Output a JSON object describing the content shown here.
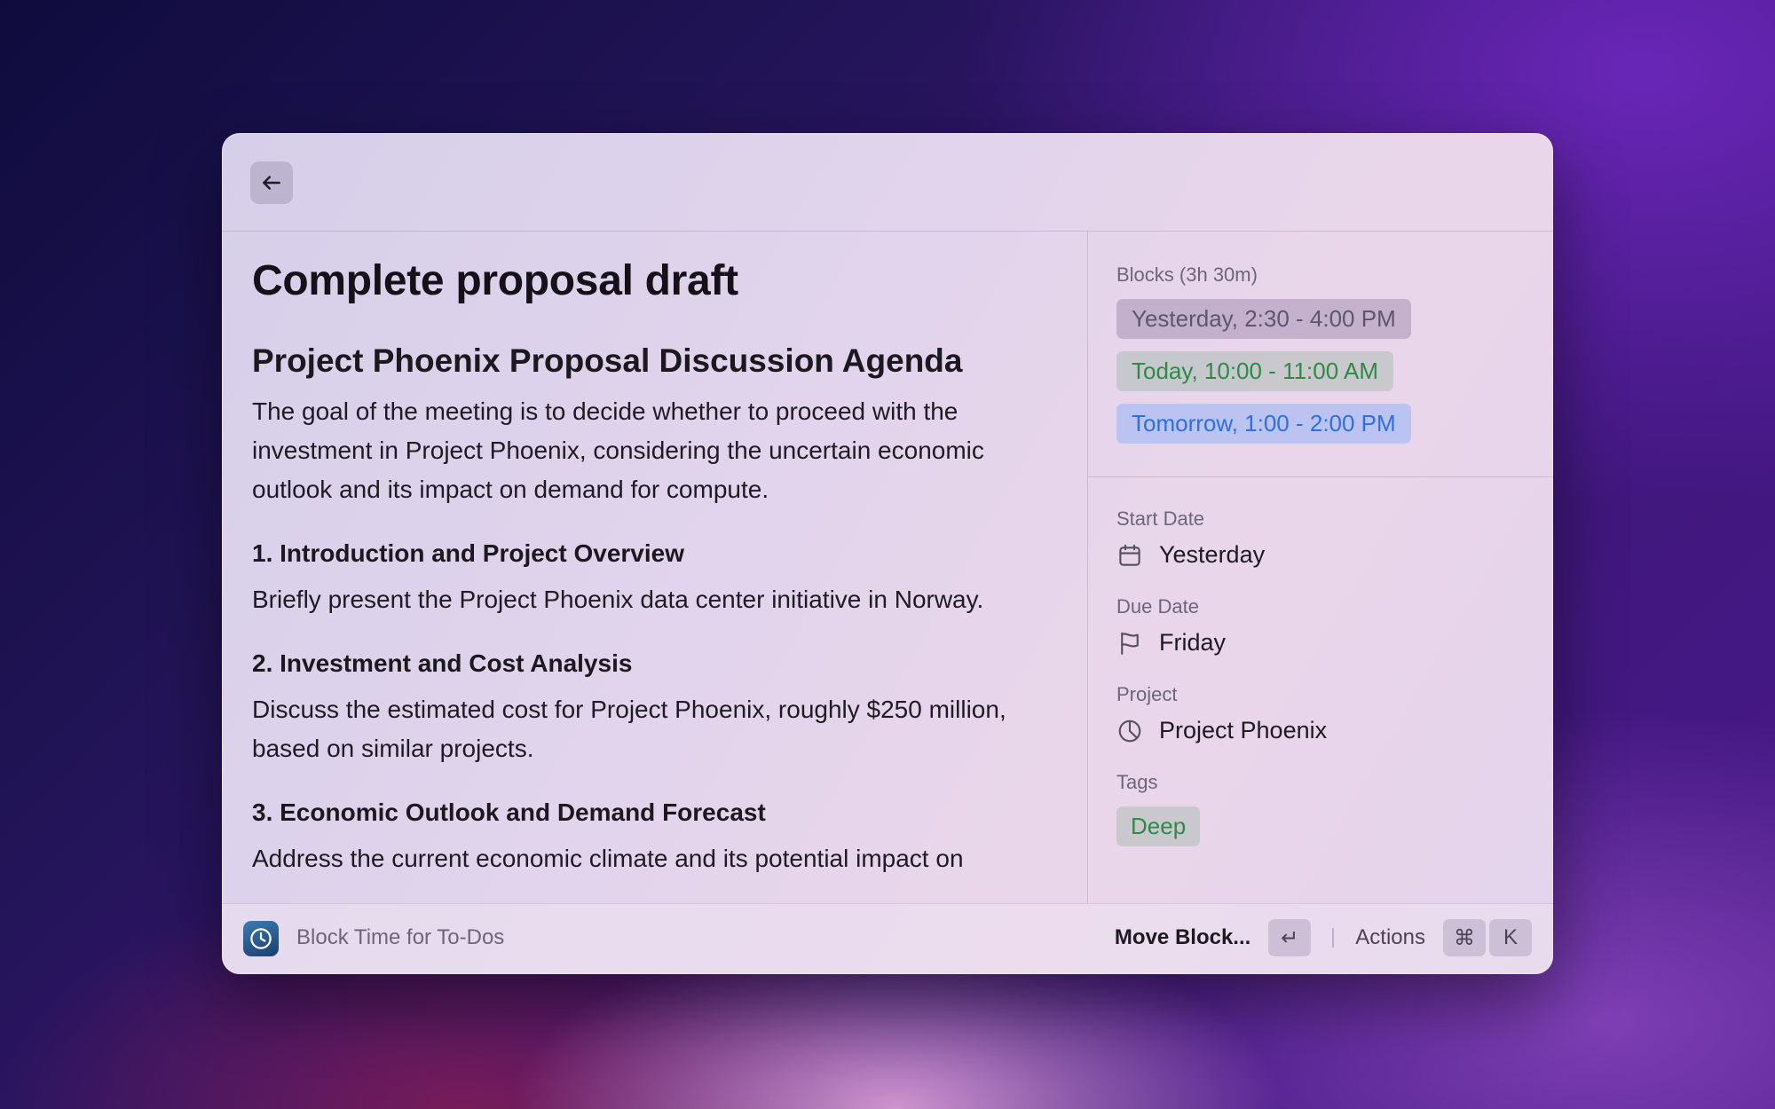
{
  "window": {
    "back_icon": "arrow-left-icon"
  },
  "document": {
    "title": "Complete proposal draft",
    "heading": "Project Phoenix Proposal Discussion Agenda",
    "intro": "The goal of the meeting is to decide whether to proceed with the investment in Project Phoenix, considering the uncertain economic outlook and its impact on demand for compute.",
    "sections": [
      {
        "title": "1. Introduction and Project Overview",
        "body": "Briefly present the Project Phoenix data center initiative in Norway."
      },
      {
        "title": "2. Investment and Cost Analysis",
        "body": "Discuss the estimated cost for Project Phoenix, roughly $250 million, based on similar projects."
      },
      {
        "title": "3. Economic Outlook and Demand Forecast",
        "body": "Address the current economic climate and its potential impact on"
      }
    ]
  },
  "sidebar": {
    "blocks_label": "Blocks (3h 30m)",
    "blocks": [
      {
        "label": "Yesterday, 2:30 - 4:00 PM",
        "state": "past",
        "color": "#5e566a"
      },
      {
        "label": "Today, 10:00 - 11:00 AM",
        "state": "today",
        "color": "#2f8a48"
      },
      {
        "label": "Tomorrow, 1:00 - 2:00 PM",
        "state": "tomorrow",
        "color": "#2f6fe0"
      }
    ],
    "start_date": {
      "label": "Start Date",
      "value": "Yesterday",
      "icon": "calendar-icon"
    },
    "due_date": {
      "label": "Due Date",
      "value": "Friday",
      "icon": "flag-icon"
    },
    "project": {
      "label": "Project",
      "value": "Project Phoenix",
      "icon": "pie-chart-icon"
    },
    "tags": {
      "label": "Tags",
      "items": [
        "Deep"
      ]
    }
  },
  "footer": {
    "app_icon": "clock-icon",
    "title": "Block Time for To-Dos",
    "primary_action": "Move Block...",
    "primary_key": "↵",
    "secondary_action": "Actions",
    "secondary_keys": [
      "⌘",
      "K"
    ]
  }
}
